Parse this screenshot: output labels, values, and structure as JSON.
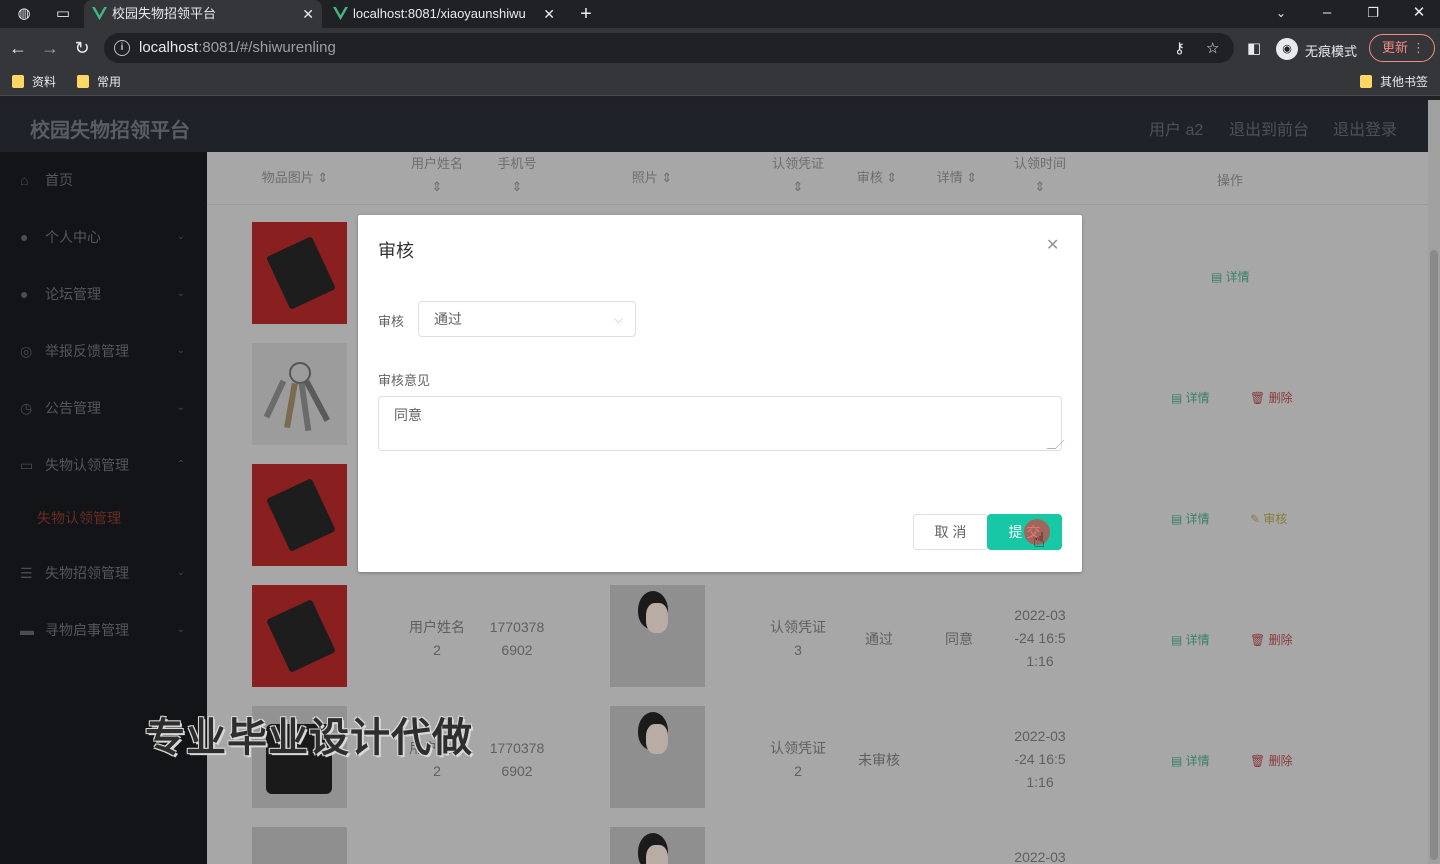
{
  "browser": {
    "tabs": [
      {
        "title": "校园失物招领平台"
      },
      {
        "title": "localhost:8081/xiaoyaunshiwu"
      }
    ],
    "url_host": "localhost",
    "url_path": ":8081/#/shiwurenling",
    "incognito_label": "无痕模式",
    "update_label": "更新",
    "bookmarks": [
      "资料",
      "常用"
    ],
    "other_bookmarks": "其他书签"
  },
  "app": {
    "title": "校园失物招领平台",
    "header_links": [
      "用户 a2",
      "退出到前台",
      "退出登录"
    ]
  },
  "sidebar": {
    "items": [
      {
        "label": "首页",
        "icon": "home-icon"
      },
      {
        "label": "个人中心",
        "icon": "user-icon"
      },
      {
        "label": "论坛管理",
        "icon": "user-icon"
      },
      {
        "label": "举报反馈管理",
        "icon": "globe-icon"
      },
      {
        "label": "公告管理",
        "icon": "clock-icon"
      },
      {
        "label": "失物认领管理",
        "icon": "card-icon"
      },
      {
        "label": "失物认领管理",
        "icon": ""
      },
      {
        "label": "失物招领管理",
        "icon": "list-icon"
      },
      {
        "label": "寻物启事管理",
        "icon": "chat-icon"
      }
    ]
  },
  "table": {
    "headers": {
      "image": "物品图片",
      "username": "用户姓名",
      "phone": "手机号",
      "photo": "照片",
      "proof": "认领凭证",
      "audit": "审核",
      "detail": "详情",
      "claim_time": "认领时间",
      "ops": "操作"
    },
    "sort_glyph": "⇕",
    "rows": [
      {
        "username_a": "用户姓名",
        "username_b": "2",
        "phone_a": "1770378",
        "phone_b": "6902",
        "proof_a": "认领凭证",
        "proof_b": "3",
        "audit": "通过",
        "detail": "同意",
        "time_a": "2022-03",
        "time_b": "-24 16:5",
        "time_c": "1:16"
      },
      {
        "username_a": "用户姓名",
        "username_b": "2",
        "phone_a": "1770378",
        "phone_b": "6902",
        "proof_a": "认领凭证",
        "proof_b": "2",
        "audit": "未审核",
        "detail": "",
        "time_a": "2022-03",
        "time_b": "-24 16:5",
        "time_c": "1:16"
      },
      {
        "time_a": "2022-03"
      }
    ],
    "actions": {
      "detail": "详情",
      "delete": "删除",
      "audit": "审核"
    }
  },
  "watermark": "专业毕业设计代做",
  "dialog": {
    "title": "审核",
    "audit_label": "审核",
    "audit_value": "通过",
    "opinion_label": "审核意见",
    "opinion_value": "同意",
    "cancel": "取 消",
    "submit": "提 交"
  }
}
